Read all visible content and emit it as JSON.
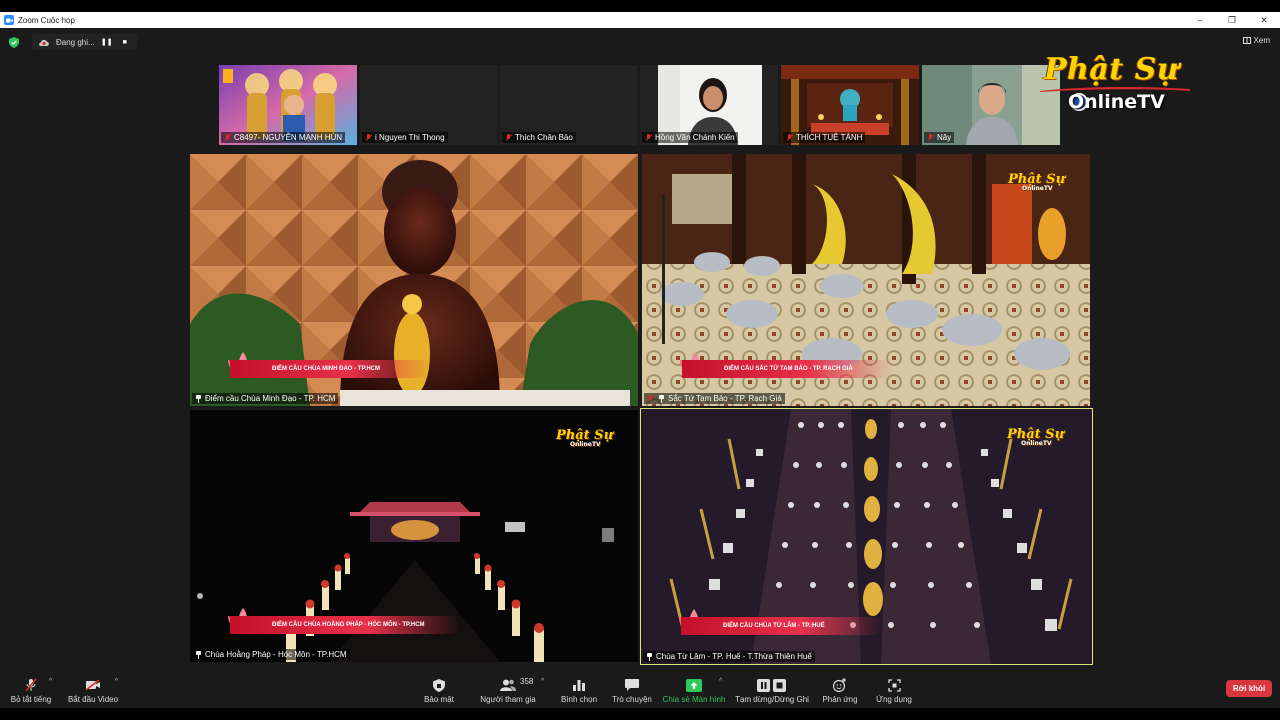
{
  "window": {
    "title": "Zoom Cuộc họp",
    "controls": [
      "–",
      "❐",
      "✕"
    ]
  },
  "status": {
    "recording_text": "Đang ghi...",
    "pause_symbol": "❚❚",
    "stop_symbol": "■",
    "view_label": "Xem"
  },
  "thumbnails": [
    {
      "name": "C8497- NGUYỄN MẠNH HÙN",
      "muted": true,
      "photo": "buddha-child-banner"
    },
    {
      "name": "i Nguyen Thi Thong",
      "muted": true,
      "photo": "blank"
    },
    {
      "name": "Thích Chân Bảo",
      "muted": true,
      "photo": "blank"
    },
    {
      "name": "Hồng Vân Chánh Kiến",
      "muted": true,
      "photo": "woman-speaker"
    },
    {
      "name": "THÍCH TUỆ TÁNH",
      "muted": true,
      "photo": "altar"
    },
    {
      "name": "Nây",
      "muted": true,
      "photo": "elderly-woman"
    }
  ],
  "logo": {
    "top": "Phật Sự",
    "bottom": "OnlineTV"
  },
  "tiles": [
    {
      "label": "Điểm cầu Chùa Minh Đạo - TP. HCM",
      "banner": "ĐIỂM CẦU CHÙA MINH ĐẠO - TP.HCM",
      "scene": "buddha-statue",
      "active": false,
      "watermark": false
    },
    {
      "label": "Sắc Tứ Tam Bảo - TP. Rạch Giá",
      "banner": "ĐIỂM CẦU SẮC TỨ TAM BẢO - TP. RẠCH GIÁ",
      "scene": "prostration",
      "active": false,
      "watermark": true
    },
    {
      "label": "Chùa Hoằng Pháp - Hóc Môn - TP.HCM",
      "banner": "ĐIỂM CẦU CHÙA HOẰNG PHÁP - HÓC MÔN - TP.HCM",
      "scene": "temple-night",
      "active": false,
      "watermark": true
    },
    {
      "label": "Chùa Từ Lâm - TP. Huế - T.Thừa Thiên Huế",
      "banner": "ĐIỂM CẦU CHÙA TỪ LÂM - TP. HUẾ",
      "scene": "candle-aisle",
      "active": true,
      "watermark": true
    }
  ],
  "watermark": {
    "top": "Phật Sự",
    "bottom": "OnlineTV"
  },
  "toolbar": {
    "mute_all": "Bỏ tắt tiếng",
    "start_video": "Bắt đầu Video",
    "security": "Bảo mật",
    "participants": "Người tham gia",
    "participants_count": "358",
    "polls": "Bình chọn",
    "chat": "Trò chuyện",
    "share_screen": "Chia sẻ Màn hình",
    "pause_recording": "Tạm dừng/Dừng Ghi",
    "reactions": "Phản ứng",
    "apps": "Ứng dụng",
    "leave": "Rời khỏi",
    "caret": "^"
  },
  "colors": {
    "accent_green": "#2ec95c",
    "leave_red": "#d9363e",
    "active_speaker": "#d8e87a",
    "logo_yellow": "#ffd400"
  }
}
